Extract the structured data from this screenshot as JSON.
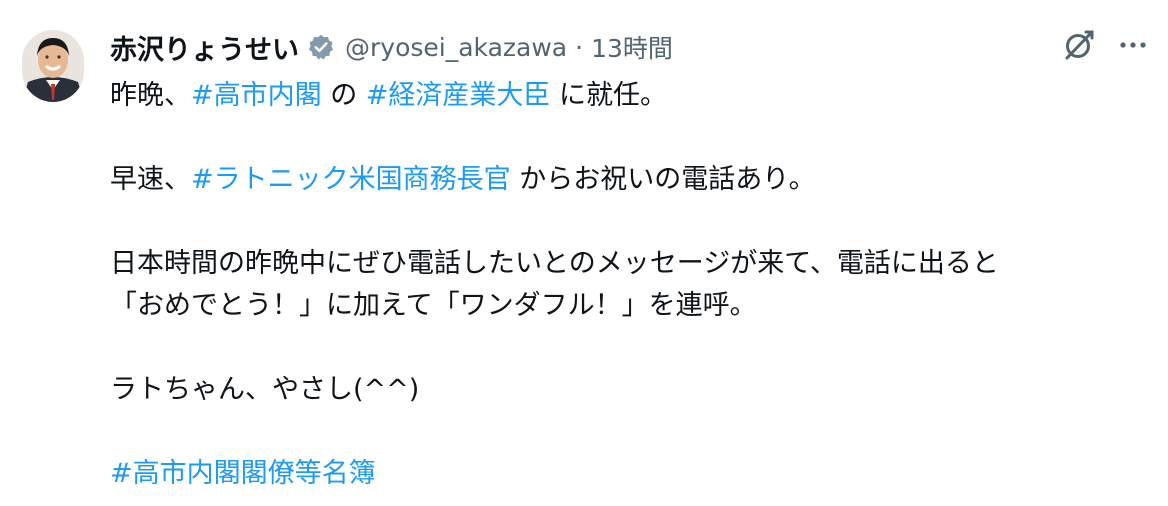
{
  "post": {
    "author": {
      "display_name": "赤沢りょうせい",
      "verified_icon": "verified-badge-icon",
      "handle": "@ryosei_akazawa",
      "separator": "·",
      "time": "13時間"
    },
    "actions": {
      "grok_icon": "grok-icon",
      "more_icon": "more-dots-icon"
    },
    "paragraphs": {
      "p1": {
        "a": "昨晩、",
        "tag1": "#高市内閣",
        "b": " の ",
        "tag2": "#経済産業大臣",
        "c": " に就任。"
      },
      "p2": {
        "a": "早速、",
        "tag1": "#ラトニック米国商務長官",
        "b": " からお祝いの電話あり。"
      },
      "p3": {
        "line1": "日本時間の昨晩中にぜひ電話したいとのメッセージが来て、電話に出ると",
        "line2": "「おめでとう！」に加えて「ワンダフル！」を連呼。"
      },
      "p4": {
        "line1": "ラトちゃん、やさし(^^)"
      },
      "p5": {
        "tag1": "#高市内閣閣僚等名簿"
      }
    },
    "colors": {
      "link": "#1d9bf0",
      "text": "#0f1419",
      "muted": "#536471",
      "verified": "#829aab"
    }
  }
}
